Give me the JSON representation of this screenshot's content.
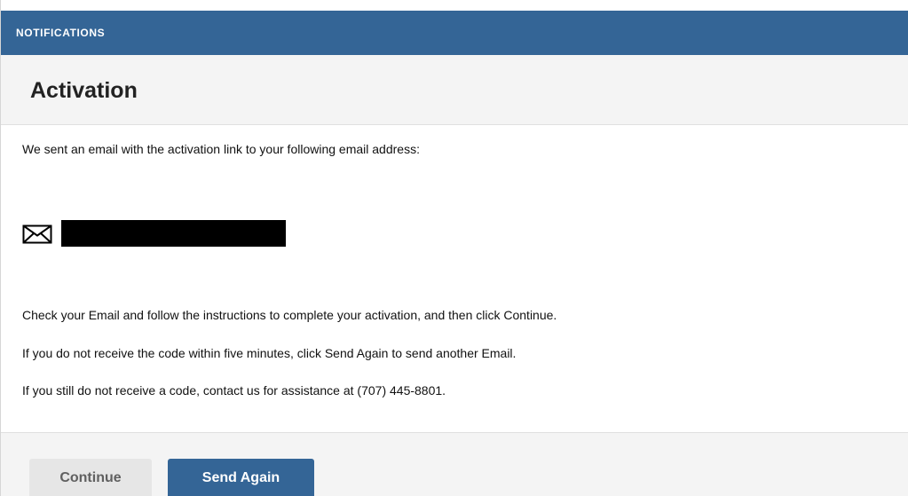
{
  "header": {
    "section_title": "NOTIFICATIONS"
  },
  "page": {
    "title": "Activation"
  },
  "content": {
    "intro": "We sent an email with the activation link to your following email address:",
    "email_icon": "envelope-icon",
    "email_value": "",
    "instructions": [
      "Check your Email and follow the instructions to complete your activation, and then click Continue.",
      "If you do not receive the code within five minutes, click Send Again to send another Email.",
      "If you still do not receive a code, contact us for assistance at (707) 445-8801."
    ]
  },
  "footer": {
    "continue_label": "Continue",
    "send_again_label": "Send Again"
  },
  "colors": {
    "brand_blue": "#346596",
    "band_gray": "#f4f4f4",
    "secondary_button": "#e6e6e6"
  }
}
